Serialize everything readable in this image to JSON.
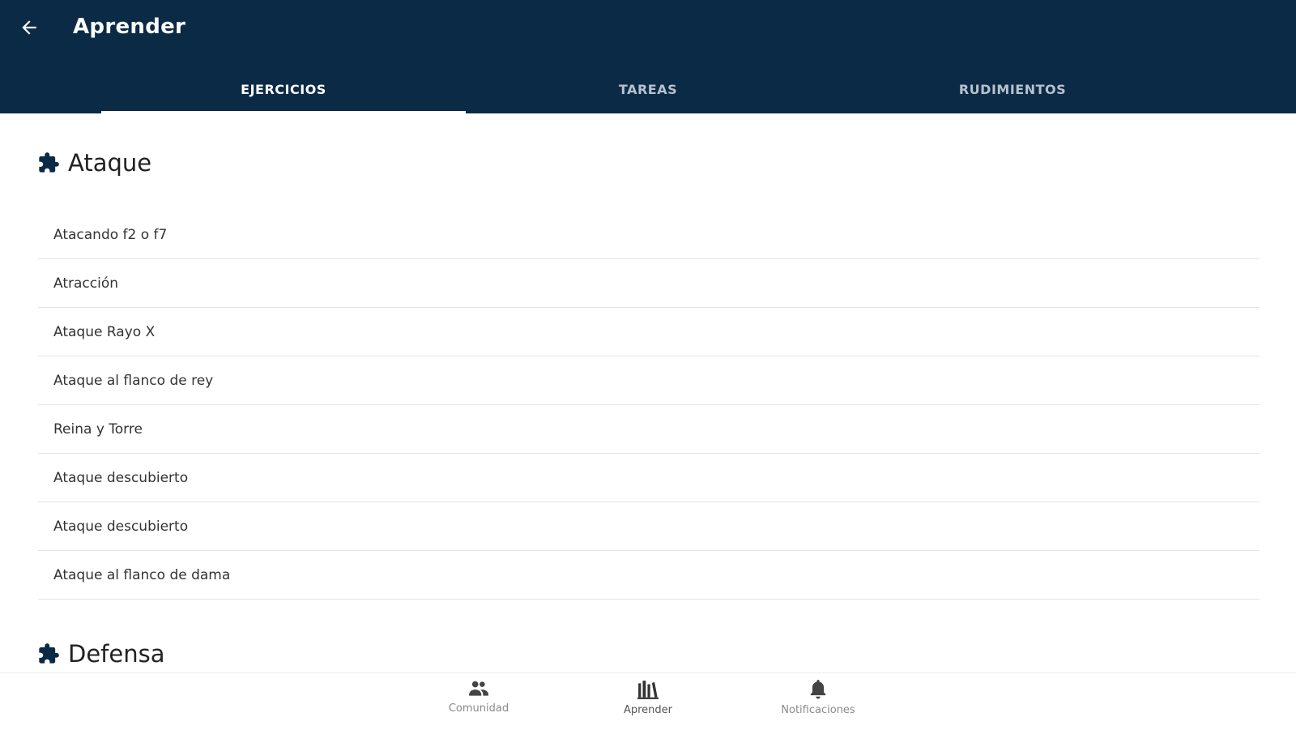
{
  "header": {
    "title": "Aprender",
    "back_icon": "arrow-left-icon",
    "background": "#0b2a45"
  },
  "tabs": [
    {
      "label": "EJERCICIOS",
      "active": true
    },
    {
      "label": "TAREAS",
      "active": false
    },
    {
      "label": "RUDIMIENTOS",
      "active": false
    }
  ],
  "sections": [
    {
      "icon": "puzzle-piece-icon",
      "title": "Ataque",
      "items": [
        "Atacando f2 o f7",
        "Atracción",
        "Ataque Rayo X",
        "Ataque al flanco de rey",
        "Reina y Torre",
        "Ataque descubierto",
        "Ataque descubierto",
        "Ataque al flanco de dama"
      ]
    },
    {
      "icon": "puzzle-piece-icon",
      "title": "Defensa",
      "items": []
    }
  ],
  "bottom_nav": [
    {
      "label": "Comunidad",
      "icon": "people-icon",
      "active": false
    },
    {
      "label": "Aprender",
      "icon": "books-icon",
      "active": true
    },
    {
      "label": "Notificaciones",
      "icon": "bell-icon",
      "active": false
    }
  ]
}
